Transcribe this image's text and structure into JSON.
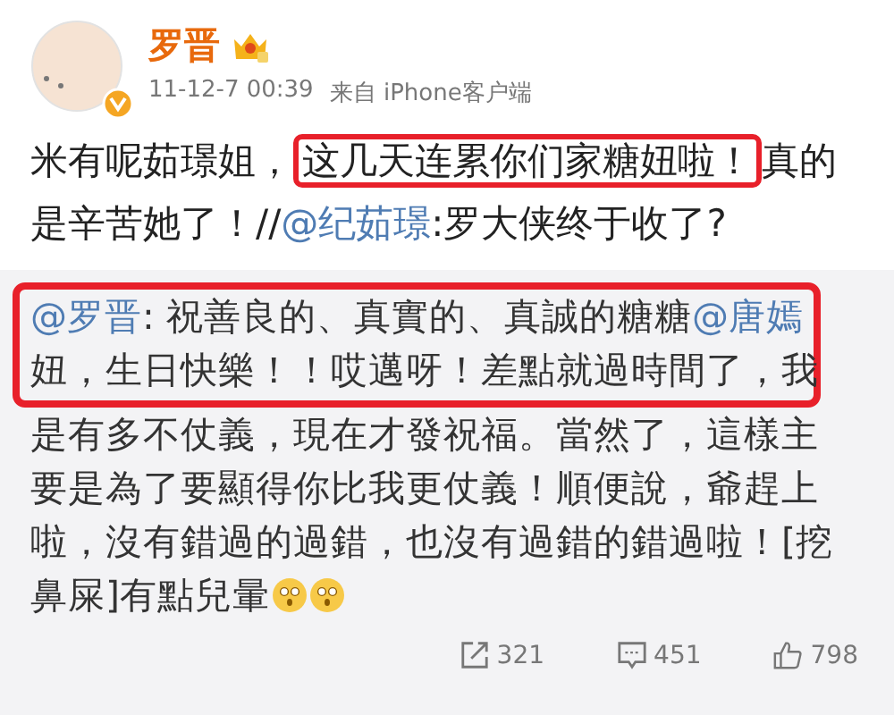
{
  "author": {
    "name": "罗晋",
    "time": "11-12-7 00:39",
    "source": "来自 iPhone客户端",
    "verified": true
  },
  "post": {
    "lines": [
      [
        {
          "kind": "text",
          "text": "米有呢茹璟姐，",
          "highlighted": false
        },
        {
          "kind": "text",
          "text": "这几天连累你们家糖妞啦！",
          "highlighted": true
        },
        {
          "kind": "text",
          "text": "真的",
          "highlighted": false
        }
      ],
      [
        {
          "kind": "text",
          "text": "是辛苦她了！//",
          "highlighted": false
        },
        {
          "kind": "link",
          "text": "@纪茹璟",
          "highlighted": false
        },
        {
          "kind": "text",
          "text": ":罗大侠终于收了?",
          "highlighted": false
        }
      ]
    ]
  },
  "repost": {
    "lines": [
      {
        "highlighted": true,
        "segments": [
          {
            "kind": "link",
            "text": "@罗晋"
          },
          {
            "kind": "text",
            "text": ": 祝善良的、真實的、真誠的糖糖"
          },
          {
            "kind": "link",
            "text": "@唐嫣"
          }
        ]
      },
      {
        "highlighted": true,
        "segments": [
          {
            "kind": "text",
            "text": "妞，生日快樂！！哎邁呀！差點就過時間了，我"
          }
        ]
      },
      {
        "highlighted": false,
        "segments": [
          {
            "kind": "text",
            "text": "是有多不仗義，現在才發祝福。當然了，這樣主"
          }
        ]
      },
      {
        "highlighted": false,
        "segments": [
          {
            "kind": "text",
            "text": "要是為了要顯得你比我更仗義！順便說，爺趕上"
          }
        ]
      },
      {
        "highlighted": false,
        "segments": [
          {
            "kind": "text",
            "text": "啦，沒有錯過的過錯，也沒有過錯的錯過啦！[挖"
          }
        ]
      },
      {
        "highlighted": false,
        "segments": [
          {
            "kind": "text",
            "text": "鼻屎]有點兒暈"
          },
          {
            "kind": "emoji"
          },
          {
            "kind": "emoji"
          }
        ]
      }
    ],
    "stats": [
      {
        "kind": "repost",
        "count": "321"
      },
      {
        "kind": "comment",
        "count": "451"
      },
      {
        "kind": "like",
        "count": "798"
      }
    ]
  }
}
